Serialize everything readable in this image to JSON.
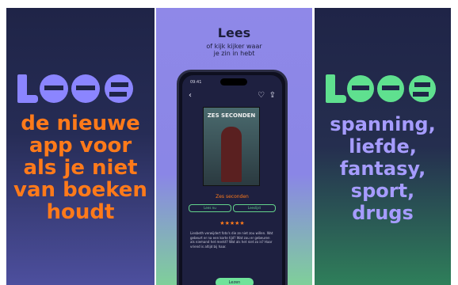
{
  "left_panel": {
    "logo": "LEES",
    "tagline": "de nieuwe\napp voor\nals je niet\nvan boeken\nhoudt",
    "colors": {
      "logo": "#8b85ff",
      "tagline": "#ff7a1a"
    }
  },
  "middle_panel": {
    "title": "Lees",
    "subtitle": "of kijk kijker waar\nje zin in hebt",
    "phone": {
      "status_time": "09:41",
      "book_cover_title": "ZES SECONDEN",
      "book_name": "Zes seconden",
      "buttons": [
        "Lees nu",
        "Leeslijst"
      ],
      "stars": "★★★★★",
      "description": "Liesbeth verwijdert foto's die ze niet zou willen. Wat gebeurt er na een korte tijd? Wat zou er gebeuren als niemand het merkt? Wat als het niet zo is? Haar vriend is altijd bij haar.",
      "cta_label": "Lezen"
    }
  },
  "right_panel": {
    "logo": "LEES",
    "tagline": "spanning,\nliefde,\nfantasy,\nsport,\ndrugs",
    "colors": {
      "logo": "#5fe08f",
      "tagline": "#a69cff"
    }
  }
}
